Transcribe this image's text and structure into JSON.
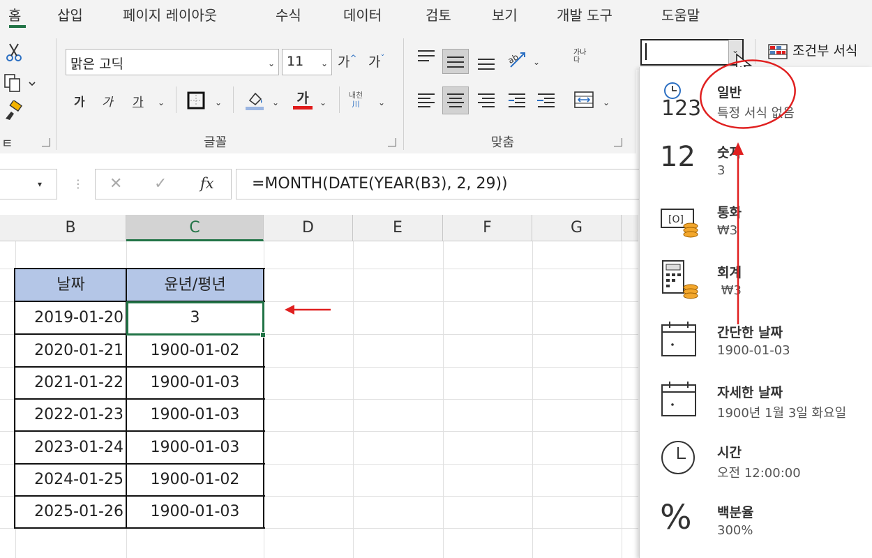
{
  "ribbon_tabs": [
    "홈",
    "삽입",
    "페이지 레이아웃",
    "수식",
    "데이터",
    "검토",
    "보기",
    "개발 도구",
    "도움말"
  ],
  "font": {
    "name": "맑은 고딕",
    "size": "11",
    "grow_label": "가",
    "shrink_label": "가",
    "bold_label": "가",
    "italic_label": "가",
    "underline_label": "가",
    "font_color_label": "가",
    "phonetic_top": "내천",
    "phonetic_bottom": "川"
  },
  "groups": {
    "font": "글꼴",
    "alignment": "맞춤"
  },
  "wrap_label": "가나\n다",
  "clipboard_partial": "ㅌ",
  "formula_bar": {
    "cancel": "✕",
    "enter": "✓",
    "fx": "fx",
    "formula": "=MONTH(DATE(YEAR(B3), 2, 29))"
  },
  "columns": [
    "B",
    "C",
    "D",
    "E",
    "F",
    "G"
  ],
  "table": {
    "headers": [
      "날짜",
      "윤년/평년"
    ],
    "rows": [
      [
        "2019-01-20",
        "3"
      ],
      [
        "2020-01-21",
        "1900-01-02"
      ],
      [
        "2021-01-22",
        "1900-01-03"
      ],
      [
        "2022-01-23",
        "1900-01-03"
      ],
      [
        "2023-01-24",
        "1900-01-03"
      ],
      [
        "2024-01-25",
        "1900-01-02"
      ],
      [
        "2025-01-26",
        "1900-01-03"
      ]
    ]
  },
  "conditional_format_label": "조건부 서식",
  "number_formats": [
    {
      "title": "일반",
      "sample": "특정 서식 없음",
      "icon": "clock-123-icon"
    },
    {
      "title": "숫자",
      "sample": "3",
      "icon": "number-12-icon"
    },
    {
      "title": "통화",
      "sample": "₩3",
      "icon": "currency-icon"
    },
    {
      "title": "회계",
      "sample": " ₩3",
      "icon": "calculator-icon"
    },
    {
      "title": "간단한 날짜",
      "sample": "1900-01-03",
      "icon": "calendar-icon"
    },
    {
      "title": "자세한 날짜",
      "sample": "1900년 1월 3일 화요일",
      "icon": "calendar-icon"
    },
    {
      "title": "시간",
      "sample": "오전 12:00:00",
      "icon": "clock-icon"
    },
    {
      "title": "백분율",
      "sample": "300%",
      "icon": "percent-icon"
    }
  ],
  "icon_labels": {
    "general_digits": "123",
    "number_digits": "12",
    "percent": "%"
  },
  "colors": {
    "accent": "#217346",
    "header_fill": "#b4c6e7",
    "annotation": "#e02020"
  }
}
